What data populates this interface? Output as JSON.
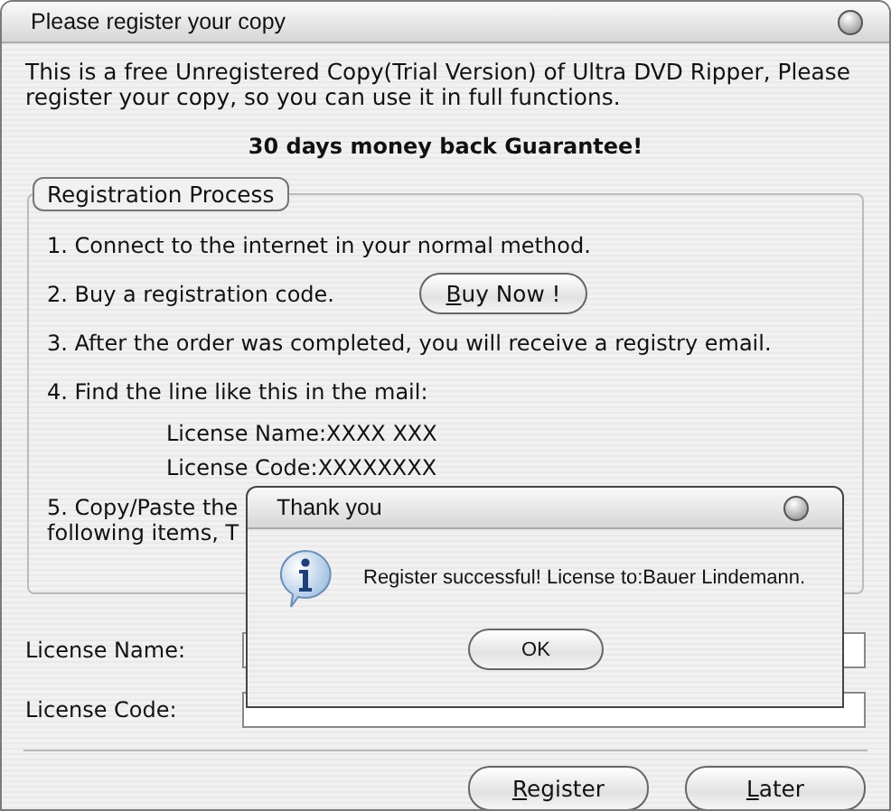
{
  "window": {
    "title": "Please register your copy"
  },
  "intro": "This is a free Unregistered Copy(Trial Version) of Ultra DVD Ripper, Please register your copy, so you can use it in full functions.",
  "guarantee": "30 days money back Guarantee!",
  "group": {
    "title": "Registration Process",
    "steps": [
      {
        "kind": "text",
        "text": "1. Connect to the internet in your normal method."
      },
      {
        "kind": "button",
        "text": "2. Buy a registration code.",
        "button": {
          "label": "Buy Now !",
          "mnemonic": true
        }
      },
      {
        "kind": "text",
        "text": "3. After the order was completed, you will receive a registry email."
      },
      {
        "kind": "text",
        "text": "4. Find the line like this in the mail:"
      },
      {
        "kind": "sample",
        "text": "License Name:XXXX XXX"
      },
      {
        "kind": "sample",
        "text": "License Code:XXXXXXXX"
      },
      {
        "kind": "text",
        "text": "5. Copy/Paste the"
      },
      {
        "kind": "wrap",
        "text": "following items, T"
      }
    ]
  },
  "fields": [
    {
      "label": "License Name:"
    },
    {
      "label": "License Code:"
    }
  ],
  "buttons": [
    {
      "label": "Register",
      "mnemonic": true
    },
    {
      "label": "Later",
      "mnemonic": true
    }
  ],
  "dialog": {
    "title": "Thank you",
    "message": "Register successful! License to:Bauer Lindemann.",
    "button": {
      "label": "OK",
      "mnemonic": false
    }
  }
}
